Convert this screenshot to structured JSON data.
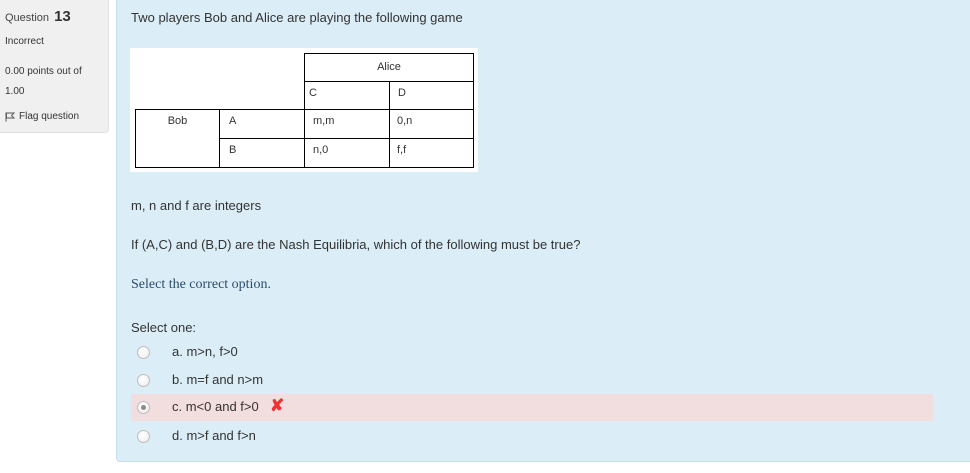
{
  "question": {
    "label": "Question",
    "number": "13",
    "state": "Incorrect",
    "grade_line1": "0.00 points out of",
    "grade_line2": "1.00",
    "flag_label": "Flag question"
  },
  "content": {
    "intro": "Two players Bob and Alice are playing the following game",
    "matrix": {
      "col_player": "Alice",
      "row_player": "Bob",
      "col_C": "C",
      "col_D": "D",
      "row_A": "A",
      "row_B": "B",
      "AC": "m,m",
      "AD": "0,n",
      "BC": "n,0",
      "BD": "f,f"
    },
    "para1": "m, n and f are integers",
    "para2": "If (A,C) and (B,D) are the Nash Equilibria, which of the following must be true?",
    "prompt": "Select the correct option.",
    "select_one": "Select one:",
    "options": [
      {
        "label": "a. m>n, f>0",
        "checked": false
      },
      {
        "label": "b. m=f and n>m",
        "checked": false
      },
      {
        "label": "c. m<0 and f>0",
        "checked": true,
        "incorrect_mark": "✘"
      },
      {
        "label": "d. m>f and f>n",
        "checked": false
      }
    ]
  },
  "colors": {
    "content_bg": "#dbedf6",
    "info_bg": "#f0f0f0",
    "incorrect_bg": "#f2dede",
    "incorrect_mark": "#e33333",
    "prompt_text": "#2b4c6b"
  }
}
